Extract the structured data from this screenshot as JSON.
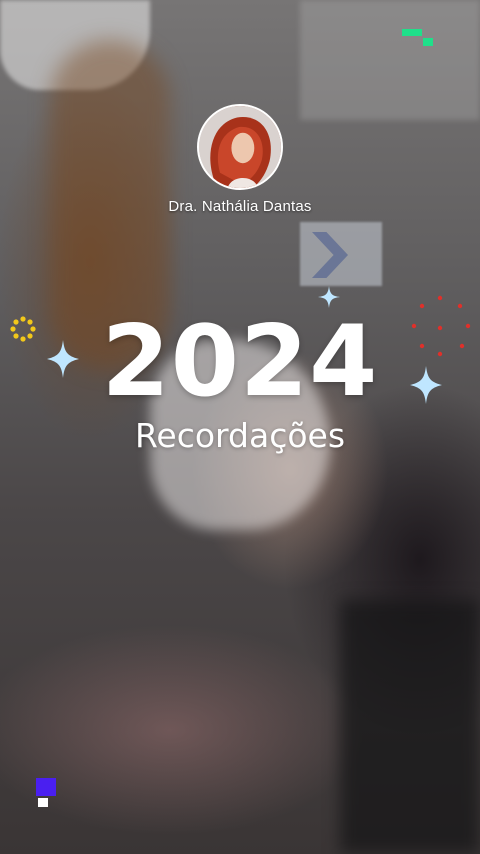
{
  "profile": {
    "name": "Dra. Nathália Dantas"
  },
  "story": {
    "year": "2024",
    "subtitle": "Recordações"
  },
  "icons": {
    "top_right": "progress-marks-icon",
    "sparkles": [
      "sparkle-small-icon",
      "sparkle-left-icon",
      "sparkle-right-icon"
    ],
    "left": "sun-ring-icon",
    "right": "dotted-arc-icon",
    "bottom_left": "pixel-marks-icon"
  },
  "colors": {
    "text": "#ffffff",
    "sparkle": "#bfe6ff",
    "accent_green": "#1fe08a",
    "accent_yellow": "#f2c81a",
    "accent_red": "#e0302a",
    "accent_purple": "#4a1ff0"
  }
}
